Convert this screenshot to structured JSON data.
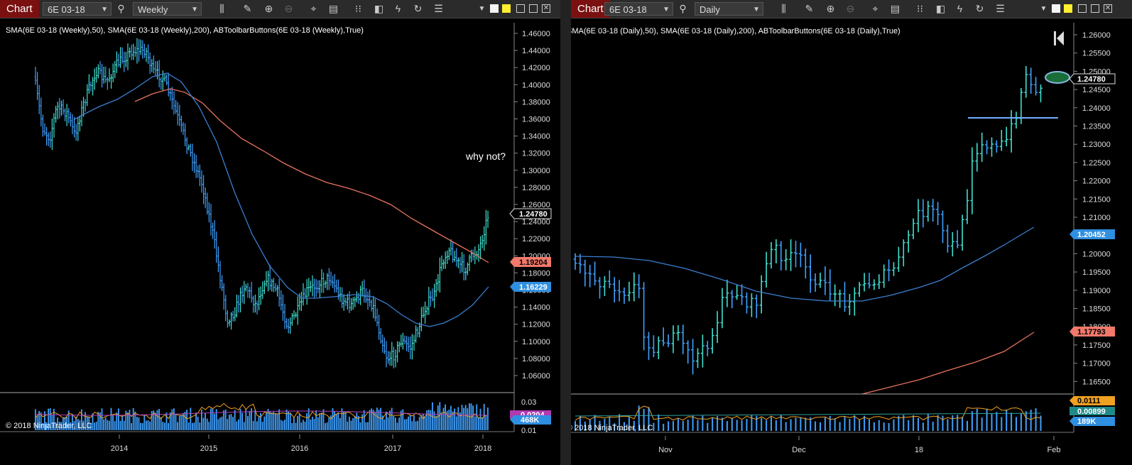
{
  "left": {
    "tab": "Chart",
    "instrument": "6E 03-18",
    "period": "Weekly",
    "indicators": "SMA(6E 03-18 (Weekly),50), SMA(6E 03-18 (Weekly),200), ABToolbarButtons(6E 03-18 (Weekly),True)",
    "annotation": "why not?",
    "copyright": "© 2018 NinjaTrader, LLC",
    "y_ticks": [
      "1.46000",
      "1.44000",
      "1.42000",
      "1.40000",
      "1.38000",
      "1.36000",
      "1.34000",
      "1.32000",
      "1.30000",
      "1.28000",
      "1.26000",
      "1.24000",
      "1.22000",
      "1.20000",
      "1.18000",
      "1.16000",
      "1.14000",
      "1.12000",
      "1.10000",
      "1.08000",
      "1.06000"
    ],
    "x_ticks": [
      "2014",
      "2015",
      "2016",
      "2017",
      "2018"
    ],
    "price_marker": "1.24780",
    "sma200_marker": "1.19204",
    "sma50_marker": "1.16229",
    "vol_ticks": [
      "0.03",
      "0.01"
    ],
    "vol_marker_hidden": "0.0204",
    "vol_marker": "468K"
  },
  "right": {
    "tab": "Chart",
    "instrument": "6E 03-18",
    "period": "Daily",
    "indicators": "SMA(6E 03-18 (Daily),50), SMA(6E 03-18 (Daily),200), ABToolbarButtons(6E 03-18 (Daily),True)",
    "copyright": "© 2018 NinjaTrader, LLC",
    "y_ticks": [
      "1.26000",
      "1.25500",
      "1.25000",
      "1.24500",
      "1.24000",
      "1.23500",
      "1.23000",
      "1.22500",
      "1.22000",
      "1.21500",
      "1.21000",
      "1.20500",
      "1.20000",
      "1.19500",
      "1.19000",
      "1.18500",
      "1.18000",
      "1.17500",
      "1.17000",
      "1.16500"
    ],
    "x_ticks": [
      "Nov",
      "Dec",
      "18",
      "Feb"
    ],
    "price_marker": "1.24780",
    "sma50_marker": "1.20452",
    "sma200_marker": "1.17793",
    "vol_marker_1": "0.0111",
    "vol_marker_2": "0.00899",
    "vol_marker_3": "189K"
  },
  "colors": {
    "tab": "#7a1010",
    "bars": "#3fa0ff",
    "bars_up": "#40e0d0",
    "sma50": "#3a7fd0",
    "sma200": "#e8735f",
    "marker_price": "#ffffff",
    "marker_sma200": "#f2796b",
    "marker_sma50": "#2f8fe0",
    "vol_line": "#f0a020"
  },
  "icons": [
    "search-icon",
    "bar-type-icon",
    "pencil-icon",
    "zoom-in-icon",
    "zoom-out-icon",
    "crosshair-icon",
    "data-box-icon",
    "hash-icon",
    "stack-icon",
    "strategy-icon",
    "reload-icon",
    "properties-icon",
    "menu-icon"
  ]
}
